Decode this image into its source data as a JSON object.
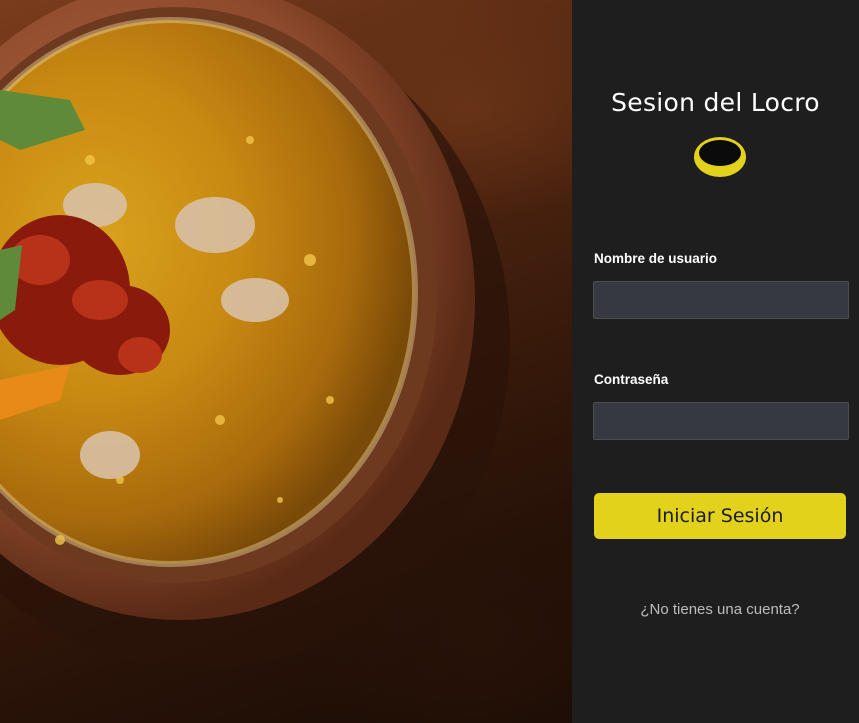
{
  "photo": {
    "subject": "locro-bowl-photo"
  },
  "login": {
    "title": "Sesion del Locro",
    "logo_icon": "yellow-bowl-logo-icon",
    "username_label": "Nombre de usuario",
    "username_value": "",
    "password_label": "Contraseña",
    "password_value": "",
    "submit_label": "Iniciar Sesión",
    "register_link": "¿No tienes una cuenta?"
  },
  "colors": {
    "panel_bg": "#1e1e1e",
    "input_bg": "#36393f",
    "accent_yellow": "#e2d21c",
    "text_white": "#ffffff",
    "link_gray": "#bdbdbd"
  }
}
